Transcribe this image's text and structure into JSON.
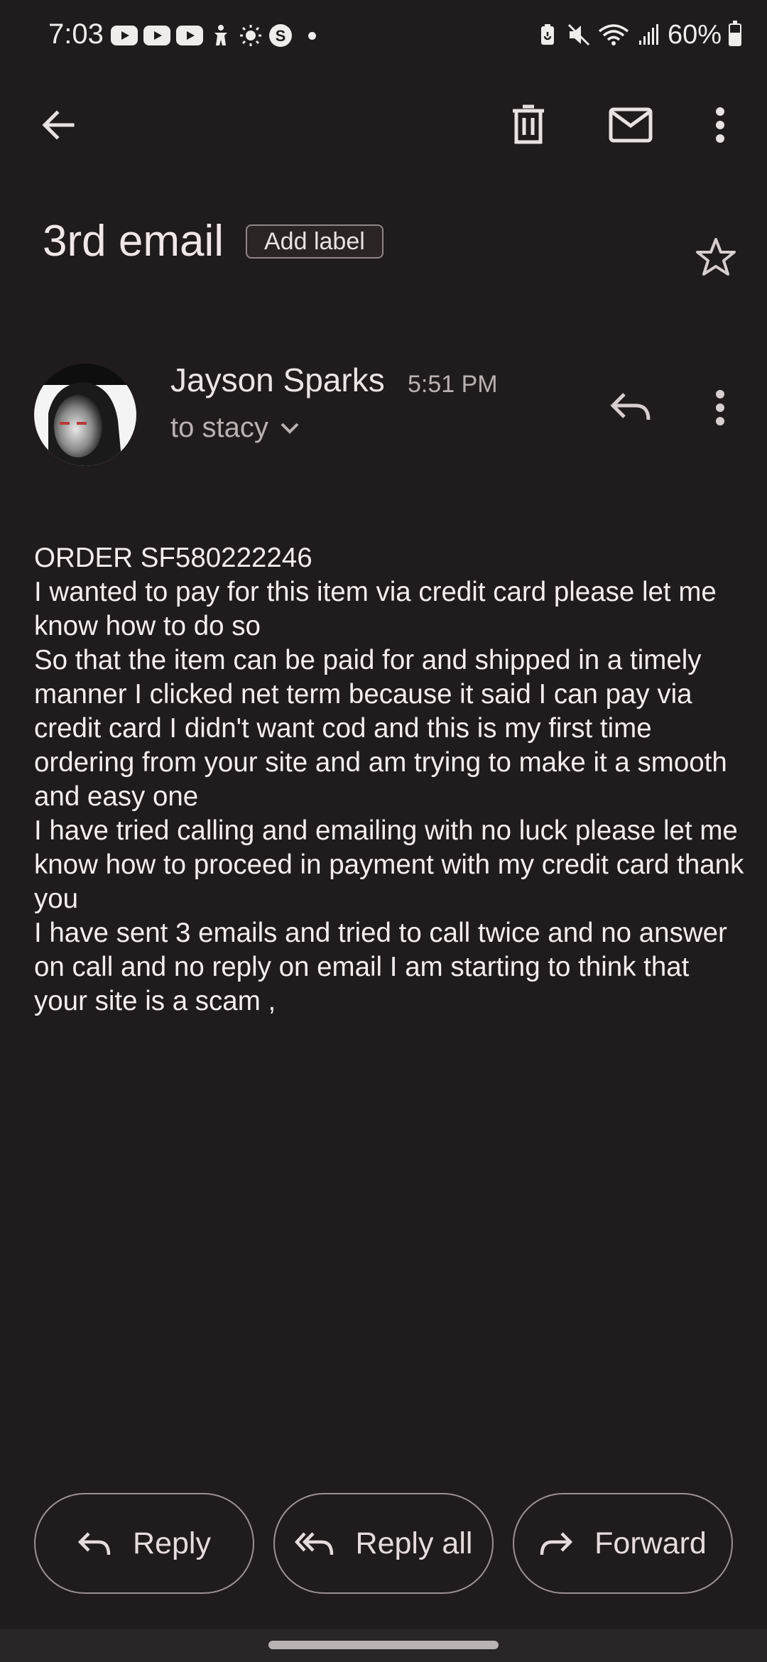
{
  "status_bar": {
    "time": "7:03",
    "battery": "60%",
    "battery_level": 0.6
  },
  "subject": "3rd email",
  "label_chip": "Add label",
  "message": {
    "sender": "Jayson Sparks",
    "time": "5:51 PM",
    "recipient": "to stacy",
    "body": [
      "ORDER SF580222246",
      "I wanted to pay for this item via credit card please let me know how to do so",
      "So that the item can be paid for and shipped in a timely manner I clicked net term because it said I can pay via credit card I didn't want cod and this is my first time ordering from your site and am trying to make it a smooth and easy one",
      "I have tried calling and emailing with no luck please let me know how to proceed in payment with my credit card thank you",
      "I have sent 3 emails and tried to call twice and no answer on call and no reply on email I am starting to think that your site is a scam ,"
    ]
  },
  "actions": {
    "reply": "Reply",
    "reply_all": "Reply all",
    "forward": "Forward"
  },
  "icons": {
    "back": "arrow-back-icon",
    "delete": "trash-icon",
    "mark_unread": "mail-icon",
    "more": "more-vert-icon",
    "star": "star-outline-icon",
    "reply": "reply-icon",
    "reply_all": "reply-all-icon",
    "forward": "forward-icon"
  },
  "colors": {
    "background": "#201b1c",
    "text": "#f4eeee",
    "muted": "#b9b1b2"
  }
}
